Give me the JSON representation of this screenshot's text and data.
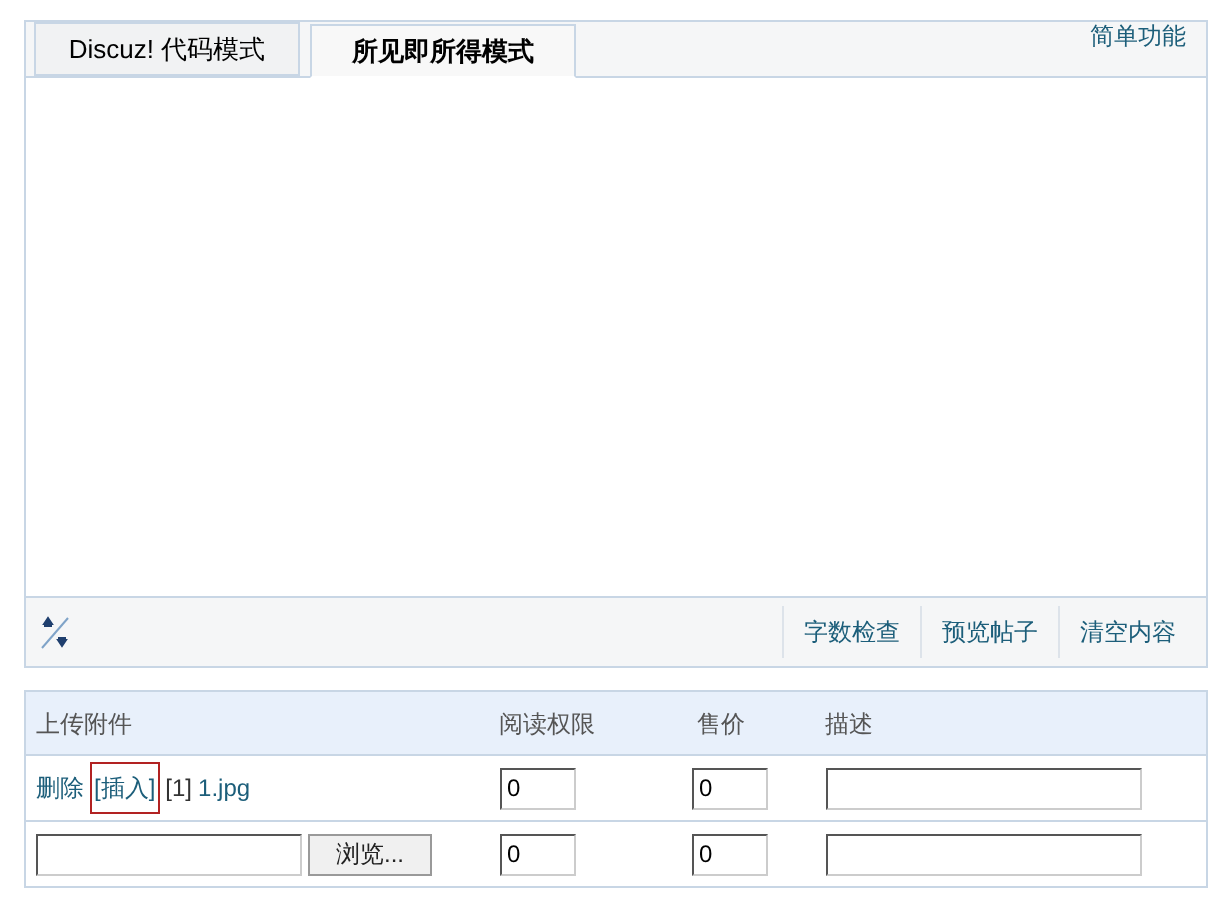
{
  "editor": {
    "tabs": [
      {
        "label": "Discuz! 代码模式",
        "selected": false
      },
      {
        "label": "所见即所得模式",
        "selected": true
      }
    ],
    "simple_link": "简单功能",
    "toolbar_buttons": [
      "字数检查",
      "预览帖子",
      "清空内容"
    ]
  },
  "attachments": {
    "columns": [
      "上传附件",
      "阅读权限",
      "售价",
      "描述"
    ],
    "rows": [
      {
        "kind": "existing",
        "delete": "删除",
        "insert": "[插入]",
        "index": "[1]",
        "file": "1.jpg",
        "permission": "0",
        "price": "0",
        "description": ""
      },
      {
        "kind": "upload",
        "browse": "浏览...",
        "permission": "0",
        "price": "0",
        "description": ""
      }
    ]
  }
}
